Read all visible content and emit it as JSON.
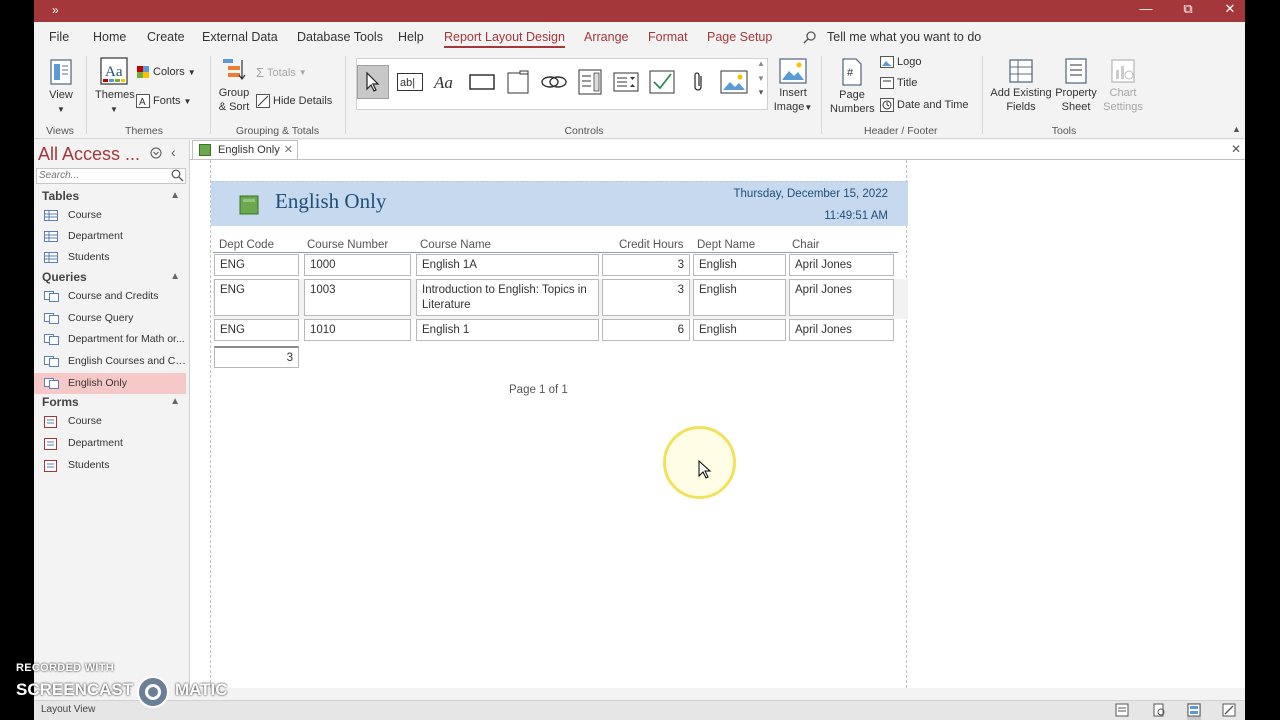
{
  "titlebar": {
    "quick_access": "»",
    "minimize": "—",
    "restore": "⧉",
    "close": "✕"
  },
  "menu": {
    "tabs": [
      "File",
      "Home",
      "Create",
      "External Data",
      "Database Tools",
      "Help",
      "Report Layout Design",
      "Arrange",
      "Format",
      "Page Setup"
    ],
    "active": "Report Layout Design",
    "tell_me": "Tell me what you want to do"
  },
  "ribbon": {
    "views": {
      "group": "Views",
      "view": "View"
    },
    "themes": {
      "group": "Themes",
      "themes": "Themes",
      "colors": "Colors",
      "fonts": "Fonts"
    },
    "grouping": {
      "group": "Grouping & Totals",
      "group_sort_1": "Group",
      "group_sort_2": "& Sort",
      "totals": "Totals",
      "hide_details": "Hide Details"
    },
    "controls": {
      "group": "Controls",
      "insert_image_1": "Insert",
      "insert_image_2": "Image"
    },
    "header_footer": {
      "group": "Header / Footer",
      "page_numbers_1": "Page",
      "page_numbers_2": "Numbers",
      "logo": "Logo",
      "title": "Title",
      "date_time": "Date and Time"
    },
    "tools": {
      "group": "Tools",
      "add_fields_1": "Add Existing",
      "add_fields_2": "Fields",
      "property_1": "Property",
      "property_2": "Sheet",
      "chart_1": "Chart",
      "chart_2": "Settings"
    }
  },
  "nav": {
    "title": "All Access ...",
    "search_placeholder": "Search...",
    "sections": [
      {
        "name": "Tables",
        "items": [
          "Course",
          "Department",
          "Students"
        ]
      },
      {
        "name": "Queries",
        "items": [
          "Course and Credits",
          "Course Query",
          "Department for Math or...",
          "English Courses and Cre...",
          "English Only"
        ]
      },
      {
        "name": "Forms",
        "items": [
          "Course",
          "Department",
          "Students"
        ]
      }
    ],
    "selected": "English Only"
  },
  "document": {
    "tab_label": "English Only",
    "tab_close": "✕",
    "close": "✕"
  },
  "report": {
    "title": "English Only",
    "date": "Thursday, December 15, 2022",
    "time": "11:49:51 AM",
    "columns": [
      "Dept Code",
      "Course Number",
      "Course Name",
      "Credit Hours",
      "Dept Name",
      "Chair"
    ],
    "rows": [
      [
        "ENG",
        "1000",
        "English 1A",
        "3",
        "English",
        "April Jones"
      ],
      [
        "ENG",
        "1003",
        "Introduction to English: Topics in Literature",
        "3",
        "English",
        "April Jones"
      ],
      [
        "ENG",
        "1010",
        "English 1",
        "6",
        "English",
        "April Jones"
      ]
    ],
    "total": "3",
    "page": "Page 1 of 1"
  },
  "status": {
    "text": "Layout View"
  },
  "watermark": {
    "line1": "RECORDED WITH",
    "screen": "SCREENCAST",
    "matic": "MATIC"
  },
  "colors": {
    "accent": "#a4373a",
    "header_band": "#c6d9ef",
    "title_text": "#1f4e79",
    "selected_nav": "#f7c8c8"
  }
}
